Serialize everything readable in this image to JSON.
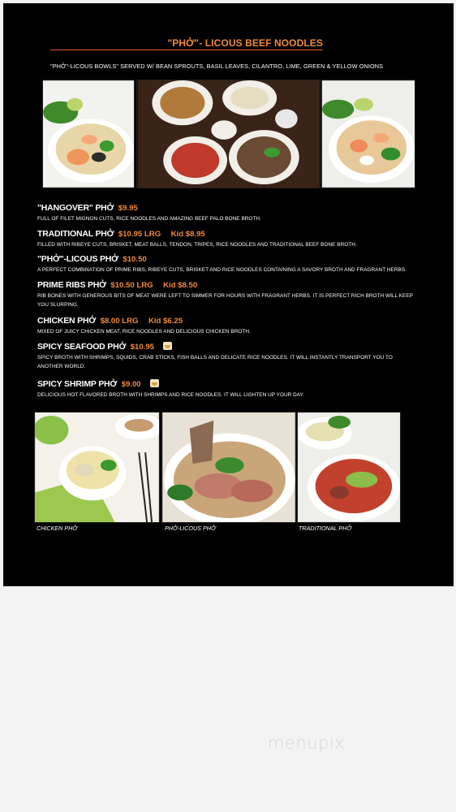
{
  "menu": {
    "title": "\"PHỞ\"- LICOUS BEEF NOODLES",
    "subtitle": "\"PHỞ\"-LICOUS BOWLS\" SERVED W/ BEAN SPROUTS, BASIL LEAVES, CILANTRO, LIME, GREEN & YELLOW ONIONS"
  },
  "items": [
    {
      "name": "\"HANGOVER\" PHỞ",
      "price": "$9.95",
      "kid": "",
      "desc": "FULL OF FILET MIGNON CUTS, RICE NOODLES AND AMAZING BEEF PALO BONE BROTH."
    },
    {
      "name": "TRADITIONAL PHỞ",
      "price": "$10.95 LRG",
      "kid": "Kid $8.95",
      "desc": "FILLED WITH RIBEYE CUTS, BRISKET, MEAT BALLS, TENDON, TRIPES, RICE NOODLES AND TRADITIONAL BEEF BONE BROTH."
    },
    {
      "name": "\"PHỞ\"-LICOUS PHỞ",
      "price": "$10.50",
      "kid": "",
      "desc": "A PERFECT COMBINATION OF PRIME RIBS, RIBEYE CUTS, BRISKET AND RICE NOODLES CONTAINING A SAVORY BROTH AND FRAGRANT HERBS."
    },
    {
      "name": "PRIME RIBS PHỞ",
      "price": "$10.50 LRG",
      "kid": "Kid $8.50",
      "desc": "RIB BONES WITH GENEROUS BITS OF MEAT WERE LEFT TO SIMMER FOR HOURS WITH FRAGRANT HERBS.  IT IS PERFECT RICH BROTH WILL KEEP YOU SLURPING."
    },
    {
      "name": "CHICKEN PHỞ",
      "price": "$8.00 LRG",
      "kid": "Kid $6.25",
      "desc": "MIXED OF JUICY CHICKEN MEAT, RICE NOODLES AND DELICIOUS CHICKEN BROTH."
    },
    {
      "name": "SPICY SEAFOOD PHỞ",
      "price": "$10.95",
      "kid": "",
      "desc": "SPICY BROTH WITH SHRIMPS, SQUIDS, CRAB STICKS, FISH BALLS AND DELICATE RICE NOODLES.  IT WILL INSTANTLY TRANSPORT YOU TO ANOTHER WORLD."
    },
    {
      "name": "SPICY SHRIMP PHỞ",
      "price": "$9.00",
      "kid": "",
      "desc": "DELICIOUS HOT FLAVORED BROTH WITH SHRIMPS AND RICE NOODLES. IT WILL LIGHTEN UP YOUR DAY."
    }
  ],
  "captions": {
    "chicken": "CHICKEN PHỞ",
    "licous": "PHỞ-LICOUS PHỞ",
    "traditional": "TRADITIONAL PHỞ"
  },
  "watermark": "menupix",
  "icons": {
    "spicy": "chili-bowl-icon"
  },
  "colors": {
    "background": "#000000",
    "accent": "#f08a3c",
    "text": "#ffffff",
    "page": "#f3f3f3"
  }
}
